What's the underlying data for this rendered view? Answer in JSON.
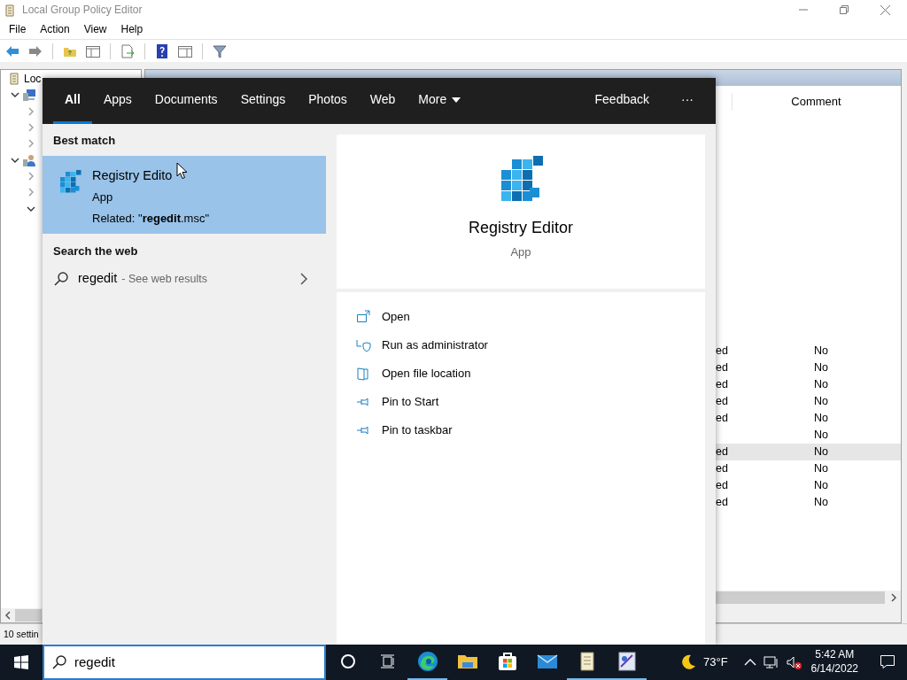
{
  "window": {
    "title": "Local Group Policy Editor",
    "menu": [
      "File",
      "Action",
      "View",
      "Help"
    ]
  },
  "tree": [
    {
      "label": "Loc",
      "children": [
        {
          "kind": "computer",
          "expanded": true,
          "children": [
            {
              "expanded": false
            },
            {
              "expanded": false
            },
            {
              "expanded": false
            }
          ]
        },
        {
          "kind": "user",
          "expanded": true,
          "children": [
            {
              "expanded": false
            },
            {
              "expanded": false
            },
            {
              "expanded": true
            }
          ]
        }
      ]
    }
  ],
  "settings_pane": {
    "columns": [
      "Comment"
    ],
    "rows": [
      {
        "column_1": "ed",
        "comment": "No",
        "selected": false
      },
      {
        "column_1": "ed",
        "comment": "No",
        "selected": false
      },
      {
        "column_1": "ed",
        "comment": "No",
        "selected": false
      },
      {
        "column_1": "ed",
        "comment": "No",
        "selected": false
      },
      {
        "column_1": "ed",
        "comment": "No",
        "selected": false
      },
      {
        "comment": "No",
        "selected": false
      },
      {
        "column_1": "ed",
        "comment": "No",
        "selected": true
      },
      {
        "column_1": "ed",
        "comment": "No",
        "selected": false
      },
      {
        "column_1": "ed",
        "comment": "No",
        "selected": false
      },
      {
        "column_1": "ed",
        "comment": "No",
        "selected": false
      }
    ]
  },
  "status_bar": "10 settin",
  "search": {
    "tabs": [
      {
        "label": "All",
        "kind": "tab",
        "selected": true
      },
      {
        "label": "Apps",
        "kind": "tab",
        "selected": false
      },
      {
        "label": "Documents",
        "kind": "tab",
        "selected": false
      },
      {
        "label": "Settings",
        "kind": "tab",
        "selected": false
      },
      {
        "label": "Photos",
        "kind": "tab",
        "selected": false
      },
      {
        "label": "Web",
        "kind": "tab",
        "selected": false
      },
      {
        "label": "More",
        "kind": "dropdown",
        "selected": false
      }
    ],
    "feedback": "Feedback",
    "more_options": "···",
    "best_match_heading": "Best match",
    "best_match": {
      "title": "Registry Edito",
      "type": "App",
      "related": "Related: \"**regedit**.msc\"",
      "selected": true
    },
    "web_heading": "Search the web",
    "web_result": {
      "query": "regedit",
      "suffix": "- See web results"
    },
    "detail": {
      "title": "Registry Editor",
      "type": "App",
      "actions": [
        {
          "label": "Open",
          "kind": "open"
        },
        {
          "label": "Run as administrator",
          "kind": "admin"
        },
        {
          "label": "Open file location",
          "kind": "location"
        },
        {
          "label": "Pin to Start",
          "kind": "pin"
        },
        {
          "label": "Pin to taskbar",
          "kind": "pin"
        }
      ]
    }
  },
  "search_box": {
    "value": "regedit"
  },
  "taskbar": {
    "apps": [
      {
        "kind": "edge",
        "running": true
      },
      {
        "kind": "explorer",
        "running": false
      },
      {
        "kind": "store",
        "running": false
      },
      {
        "kind": "mail",
        "running": false
      },
      {
        "kind": "policy",
        "running": true
      },
      {
        "kind": "paint",
        "running": true
      }
    ],
    "weather": "73°F",
    "time": "5:42 AM",
    "date": "6/14/2022"
  }
}
